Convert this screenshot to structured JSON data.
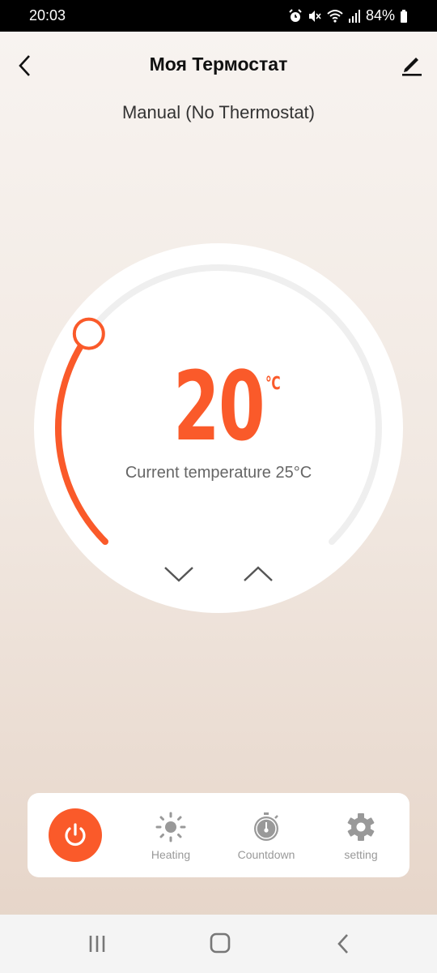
{
  "status_bar": {
    "time": "20:03",
    "battery": "84%",
    "icons": [
      "alarm-icon",
      "mute-icon",
      "wifi-icon",
      "signal-icon",
      "battery-icon"
    ]
  },
  "header": {
    "title": "Моя Термостат",
    "back_icon": "chevron-left-icon",
    "edit_icon": "pencil-icon"
  },
  "mode": "Manual (No Thermostat)",
  "dial": {
    "set_temperature": "20",
    "unit": "℃",
    "current_temperature_label": "Current temperature 25°C",
    "set_fraction": 0.3,
    "accent_color": "#fa5a2a",
    "track_color": "#efefef"
  },
  "toolbar": {
    "items": [
      {
        "label": "",
        "icon": "power-icon"
      },
      {
        "label": "Heating",
        "icon": "sun-icon"
      },
      {
        "label": "Countdown",
        "icon": "stopwatch-icon"
      },
      {
        "label": "setting",
        "icon": "gear-icon"
      }
    ]
  },
  "nav": {
    "icons": [
      "recents-icon",
      "home-icon",
      "back-icon"
    ]
  }
}
